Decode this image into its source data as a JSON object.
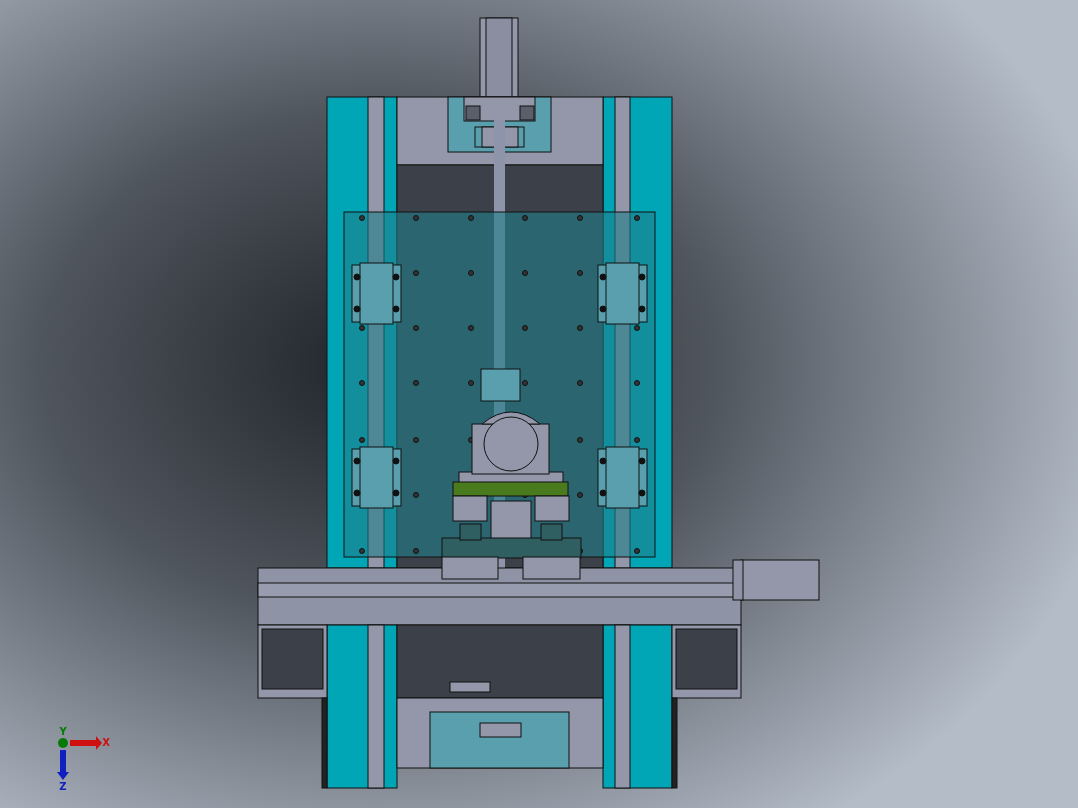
{
  "viewport": {
    "triad": {
      "axes": [
        {
          "kind": "x",
          "label": "X",
          "color": "#d01010"
        },
        {
          "kind": "y",
          "label": "Y",
          "color": "#067a06"
        },
        {
          "kind": "z",
          "label": "Z",
          "color": "#1020c0"
        }
      ]
    }
  }
}
